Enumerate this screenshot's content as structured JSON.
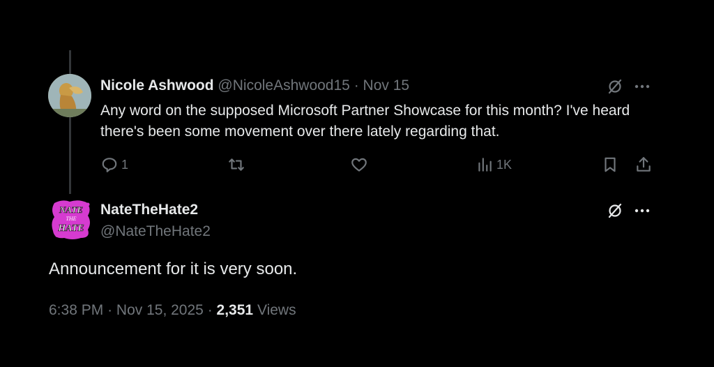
{
  "colors": {
    "background": "#000000",
    "text_primary": "#e7e9ea",
    "text_muted": "#71767b",
    "thread_line": "#333639",
    "avatar_brand": "#d63bd0"
  },
  "reply_tweet": {
    "author_name": "Nicole Ashwood",
    "handle": "@NicoleAshwood15",
    "separator": "·",
    "date": "Nov 15",
    "text": "Any word on the supposed Microsoft Partner Showcase for this month? I've heard there's been some movement over there lately regarding that.",
    "actions": {
      "replies": "1",
      "reposts": "",
      "likes": "",
      "views": "1K"
    },
    "icons": [
      "grok-icon",
      "more-icon",
      "reply-icon",
      "repost-icon",
      "like-icon",
      "views-icon",
      "bookmark-icon",
      "share-icon"
    ]
  },
  "main_tweet": {
    "author_name": "NateTheHate2",
    "handle": "@NateTheHate2",
    "avatar_text": [
      "NATE",
      "THE",
      "HATE"
    ],
    "text": "Announcement for it is very soon.",
    "time": "6:38 PM",
    "separator": "·",
    "date": "Nov 15, 2025",
    "views_count": "2,351",
    "views_label": "Views"
  }
}
